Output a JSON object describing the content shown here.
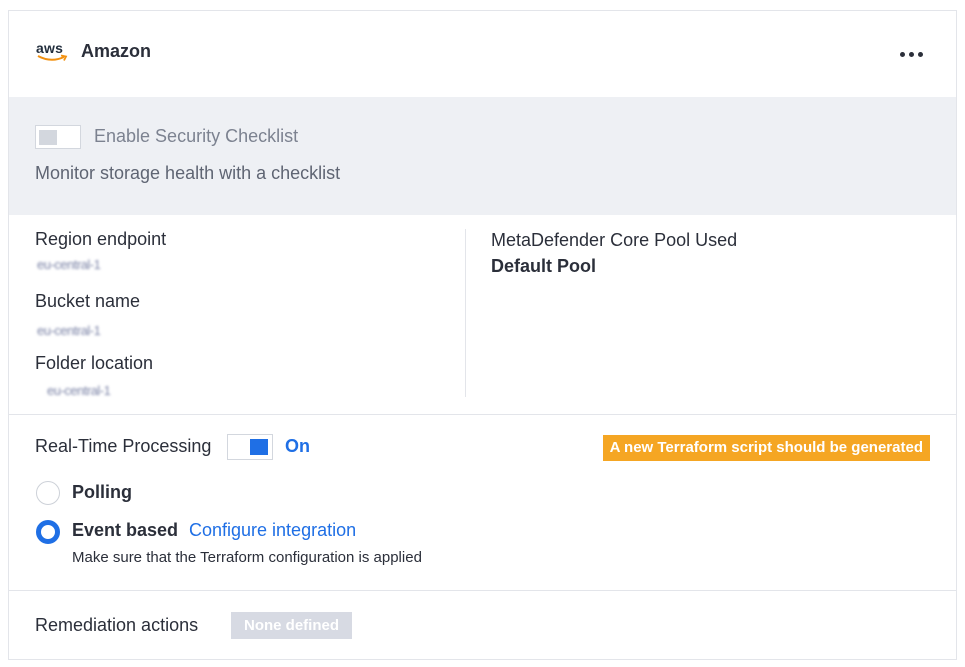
{
  "header": {
    "logo_text": "aws",
    "provider_name": "Amazon",
    "more_icon": "more-horizontal-icon"
  },
  "security": {
    "toggle_state": "off",
    "label": "Enable Security Checklist",
    "description": "Monitor storage health with a checklist"
  },
  "details": {
    "region_label": "Region endpoint",
    "region_value": "eu-central-1",
    "bucket_label": "Bucket name",
    "bucket_value": "eu-central-1",
    "folder_label": "Folder location",
    "folder_value": "eu-central-1",
    "pool_label": "MetaDefender Core Pool Used",
    "pool_value": "Default Pool"
  },
  "processing": {
    "label": "Real-Time Processing",
    "toggle_state": "on",
    "state_text": "On",
    "warning": "A new Terraform script should be generated",
    "options": [
      {
        "label": "Polling",
        "selected": false
      },
      {
        "label": "Event based",
        "selected": true
      }
    ],
    "configure_link": "Configure integration",
    "event_hint": "Make sure that the Terraform configuration is applied"
  },
  "remediation": {
    "label": "Remediation actions",
    "value": "None defined"
  },
  "colors": {
    "accent": "#1f6fe5",
    "warning": "#f5a623",
    "section_bg": "#eef0f4",
    "muted_badge": "#d7dae3"
  }
}
